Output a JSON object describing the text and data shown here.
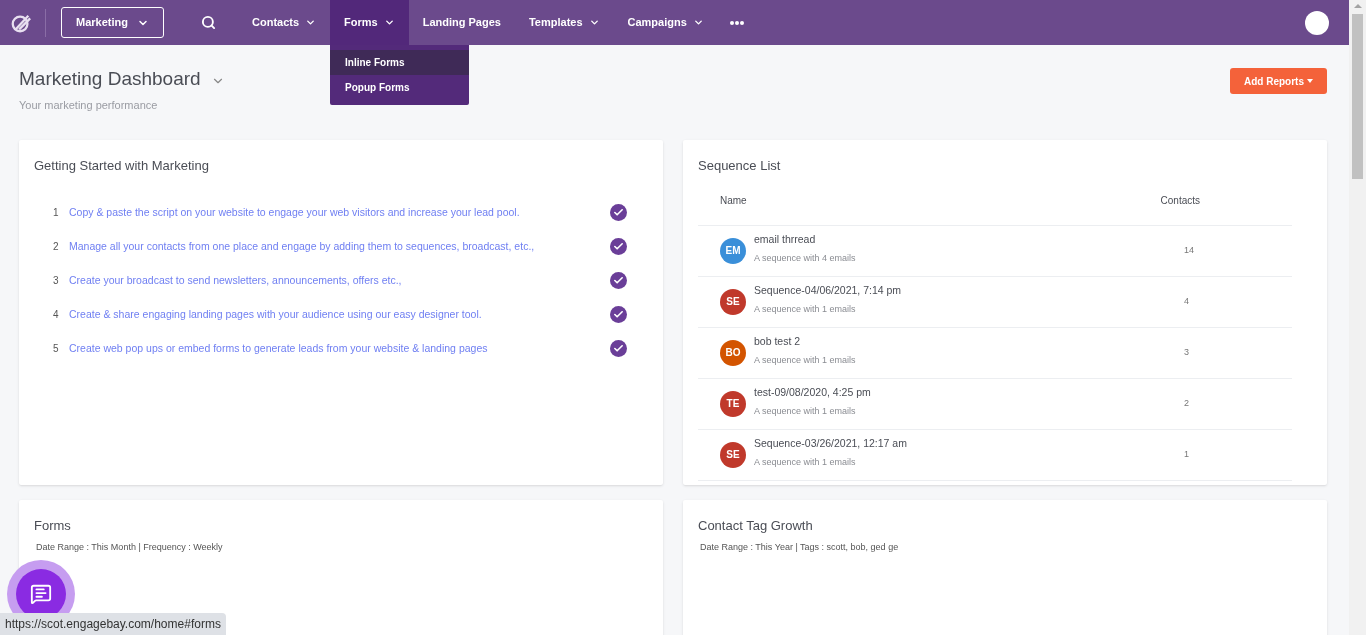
{
  "nav": {
    "app_select": "Marketing",
    "items": [
      {
        "label": "Contacts",
        "caret": true,
        "selected": false
      },
      {
        "label": "Forms",
        "caret": true,
        "selected": true
      },
      {
        "label": "Landing Pages",
        "caret": false,
        "selected": false
      },
      {
        "label": "Templates",
        "caret": true,
        "selected": false
      },
      {
        "label": "Campaigns",
        "caret": true,
        "selected": false
      }
    ],
    "dropdown": [
      {
        "label": "Inline Forms",
        "selected": true
      },
      {
        "label": "Popup Forms",
        "selected": false
      }
    ]
  },
  "page": {
    "title": "Marketing Dashboard",
    "subtitle": "Your marketing performance",
    "add_button": "Add Reports"
  },
  "getting_started": {
    "title": "Getting Started with Marketing",
    "steps": [
      {
        "number": "1",
        "text": "Copy & paste the script on your website to engage your web visitors and increase your lead pool.",
        "checked": true
      },
      {
        "number": "2",
        "text": "Manage all your contacts from one place and engage by adding them to sequences, broadcast, etc.,",
        "checked": true
      },
      {
        "number": "3",
        "text": "Create your broadcast to send newsletters, announcements, offers etc.,",
        "checked": true
      },
      {
        "number": "4",
        "text": "Create & share engaging landing pages with your audience using our easy designer tool.",
        "checked": true
      },
      {
        "number": "5",
        "text": "Create web pop ups or embed forms to generate leads from your website & landing pages",
        "checked": true
      }
    ]
  },
  "sequence_list": {
    "title": "Sequence List",
    "columns": [
      "Name",
      "Contacts"
    ],
    "rows": [
      {
        "initials": "EM",
        "color": "#3a8fd9",
        "name": "email thrread",
        "description": "A sequence with 4 emails",
        "contacts": "14"
      },
      {
        "initials": "SE",
        "color": "#c0392b",
        "name": "Sequence-04/06/2021, 7:14 pm",
        "description": "A sequence with 1 emails",
        "contacts": "4"
      },
      {
        "initials": "BO",
        "color": "#d35400",
        "name": "bob test 2",
        "description": "A sequence with 1 emails",
        "contacts": "3"
      },
      {
        "initials": "TE",
        "color": "#c0392b",
        "name": "test-09/08/2020, 4:25 pm",
        "description": "A sequence with 1 emails",
        "contacts": "2"
      },
      {
        "initials": "SE",
        "color": "#c0392b",
        "name": "Sequence-03/26/2021, 12:17 am",
        "description": "A sequence with 1 emails",
        "contacts": "1"
      }
    ]
  },
  "forms_card": {
    "title": "Forms",
    "meta": "Date Range : This Month | Frequency : Weekly"
  },
  "tag_card": {
    "title": "Contact Tag Growth",
    "meta": "Date Range : This Year | Tags : scott, bob, ged ge"
  },
  "status_url": "https://scot.engagebay.com/home#forms"
}
